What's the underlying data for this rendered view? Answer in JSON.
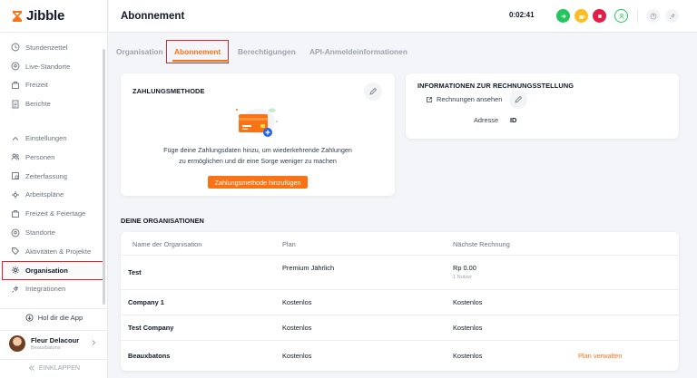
{
  "app": {
    "name": "Jibble"
  },
  "sidebar": {
    "items": [
      {
        "id": "timesheets",
        "label": "Stundenzettel",
        "icon": "clock-icon"
      },
      {
        "id": "live-locations",
        "label": "Live-Standorte",
        "icon": "location-pin-icon"
      },
      {
        "id": "time-off",
        "label": "Freizeit",
        "icon": "beach-icon"
      },
      {
        "id": "reports",
        "label": "Berichte",
        "icon": "report-icon"
      }
    ],
    "settings": [
      {
        "id": "settings",
        "label": "Einstellungen",
        "icon": "chevron-up-icon"
      },
      {
        "id": "people",
        "label": "Personen",
        "icon": "people-icon"
      },
      {
        "id": "time-tracking",
        "label": "Zeiterfassung",
        "icon": "time-tracking-icon"
      },
      {
        "id": "schedules",
        "label": "Arbeitspläne",
        "icon": "schedule-icon"
      },
      {
        "id": "holidays",
        "label": "Freizeit & Feiertage",
        "icon": "holiday-icon"
      },
      {
        "id": "locations",
        "label": "Standorte",
        "icon": "location-pin-icon"
      },
      {
        "id": "activities",
        "label": "Aktivitäten & Projekte",
        "icon": "tag-icon"
      },
      {
        "id": "organization",
        "label": "Organisation",
        "icon": "gear-icon"
      },
      {
        "id": "integrations",
        "label": "Integrationen",
        "icon": "plug-icon"
      }
    ],
    "get_app": "Hol dir die App",
    "user": {
      "name": "Fleur Delacour",
      "org": "Beauxbatons"
    },
    "collapse": "EINKLAPPEN"
  },
  "header": {
    "title": "Abonnement",
    "timer": "0:02:41"
  },
  "tabs": [
    {
      "id": "org",
      "label": "Organisation"
    },
    {
      "id": "subscription",
      "label": "Abonnement"
    },
    {
      "id": "permissions",
      "label": "Berechtigungen"
    },
    {
      "id": "api",
      "label": "API-Anmeldeinformationen"
    }
  ],
  "payment": {
    "title": "ZAHLUNGSMETHODE",
    "desc_line1": "Füge deine Zahlungsdaten hinzu, um wiederkehrende Zahlungen",
    "desc_line2": "zu ermöglichen und dir eine Sorge weniger zu machen",
    "button": "Zahlungsmethode hinzufügen"
  },
  "billing": {
    "title": "INFORMATIONEN ZUR RECHNUNGSSTELLUNG",
    "view_invoices": "Rechnungen ansehen",
    "address_label": "Adresse",
    "address_value": "ID"
  },
  "orgs": {
    "title": "DEINE ORGANISATIONEN",
    "columns": [
      "Name der Organisation",
      "Plan",
      "Nächste Rechnung"
    ],
    "rows": [
      {
        "name": "Test",
        "plan": "Premium Jährlich",
        "next": "Rp 0.00",
        "next_sub": "1 Nutzer",
        "action": ""
      },
      {
        "name": "Company 1",
        "plan": "Kostenlos",
        "next": "Kostenlos",
        "next_sub": "",
        "action": ""
      },
      {
        "name": "Test Company",
        "plan": "Kostenlos",
        "next": "Kostenlos",
        "next_sub": "",
        "action": ""
      },
      {
        "name": "Beauxbatons",
        "plan": "Kostenlos",
        "next": "Kostenlos",
        "next_sub": "",
        "action": "Plan verwalten"
      }
    ]
  },
  "colors": {
    "accent": "#f97316",
    "highlight": "#d9262c",
    "green": "#22c55e",
    "yellow": "#fbbf24",
    "red": "#e11d48"
  }
}
